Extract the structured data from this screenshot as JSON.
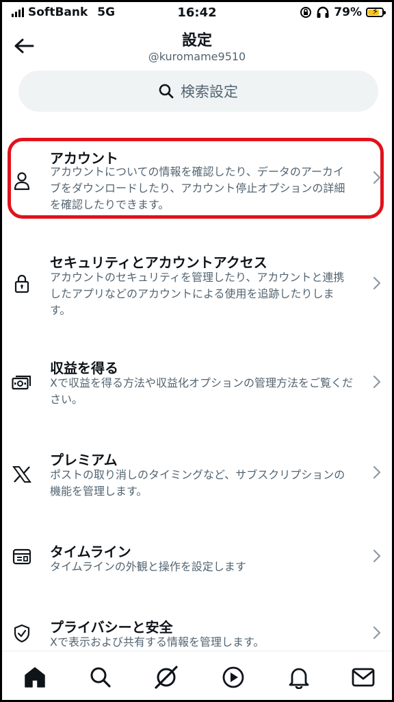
{
  "status_bar": {
    "carrier": "SoftBank",
    "network": "5G",
    "time": "16:42",
    "battery_percent": "79%",
    "battery_level": 0.79,
    "battery_color": "#f3c420"
  },
  "header": {
    "title": "設定",
    "username": "@kuromame9510",
    "back_icon": "arrow-left-icon"
  },
  "search": {
    "icon": "search-icon",
    "label": "検索設定"
  },
  "settings": [
    {
      "icon": "person-icon",
      "title": "アカウント",
      "description": "アカウントについての情報を確認したり、データのアーカイブをダウンロードしたり、アカウント停止オプションの詳細を確認したりできます。",
      "highlighted": true
    },
    {
      "icon": "lock-icon",
      "title": "セキュリティとアカウントアクセス",
      "description": "アカウントのセキュリティを管理したり、アカウントと連携したアプリなどのアカウントによる使用を追跡したりします。"
    },
    {
      "icon": "money-icon",
      "title": "収益を得る",
      "description": "Xで収益を得る方法や収益化オプションの管理方法をご覧ください。"
    },
    {
      "icon": "x-logo-icon",
      "title": "プレミアム",
      "description": "ポストの取り消しのタイミングなど、サブスクリプションの機能を管理します。"
    },
    {
      "icon": "timeline-icon",
      "title": "タイムライン",
      "description": "タイムラインの外観と操作を設定します"
    },
    {
      "icon": "shield-icon",
      "title": "プライバシーと安全",
      "description": "Xで表示および共有する情報を管理します。"
    }
  ],
  "bottom_nav": [
    "home-icon",
    "search-icon",
    "grok-icon",
    "play-icon",
    "bell-icon",
    "mail-icon"
  ],
  "colors": {
    "highlight": "#e0121b",
    "text_primary": "#0f1419",
    "text_secondary": "#536471",
    "search_bg": "#eff3f4"
  }
}
